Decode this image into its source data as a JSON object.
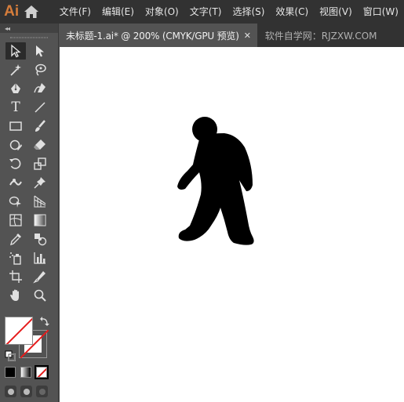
{
  "app": {
    "logo": "Ai"
  },
  "menu": [
    "文件(F)",
    "编辑(E)",
    "对象(O)",
    "文字(T)",
    "选择(S)",
    "效果(C)",
    "视图(V)",
    "窗口(W)"
  ],
  "panel": {
    "collapse_label": "◂◂"
  },
  "tools": {
    "type_label": "T"
  },
  "tabs": {
    "document": "未标题-1.ai* @ 200% (CMYK/GPU 预览)",
    "close": "✕",
    "watermark": "软件自学网：RJZXW.COM"
  },
  "colors": {
    "menubar": "#323232",
    "panel": "#535353",
    "accent_logo": "#d67d3b",
    "none_slash": "#e61c1c",
    "shape_fill": "#000000"
  }
}
